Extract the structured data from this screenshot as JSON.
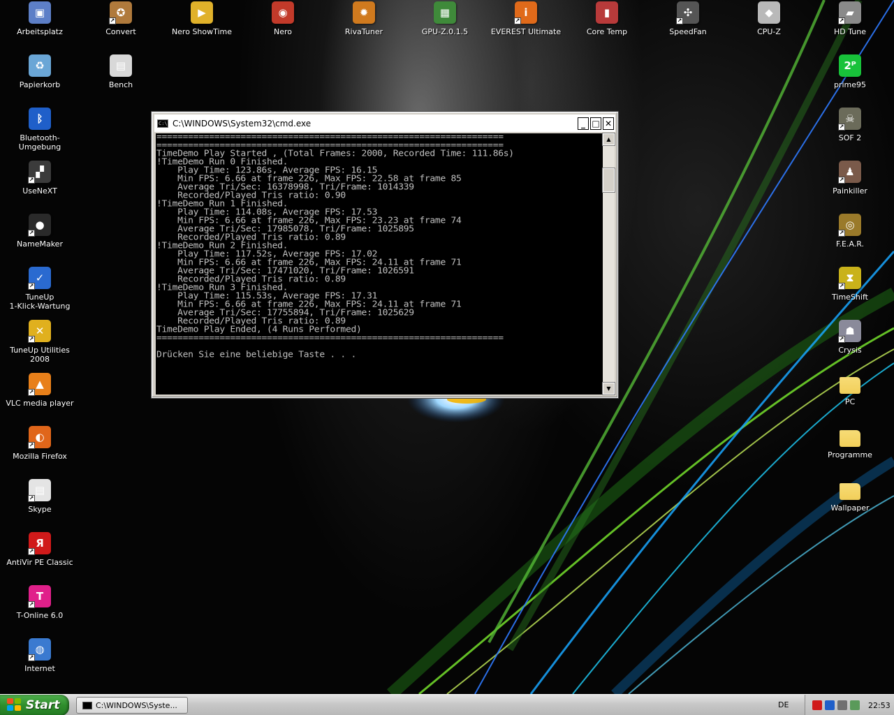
{
  "desktop": {
    "icons": [
      {
        "label": "Arbeitsplatz",
        "icon": "my-computer-icon",
        "color": "#5d7fc7",
        "glyph": "▣",
        "shortcut": false
      },
      {
        "label": "Convert",
        "icon": "convert-icon",
        "color": "#b07a3c",
        "glyph": "✪",
        "shortcut": true
      },
      {
        "label": "Nero ShowTime",
        "icon": "nero-showtime-icon",
        "color": "#e0b12a",
        "glyph": "▶",
        "shortcut": false
      },
      {
        "label": "Nero",
        "icon": "nero-icon",
        "color": "#c23a2a",
        "glyph": "◉",
        "shortcut": false
      },
      {
        "label": "RivaTuner",
        "icon": "rivatuner-icon",
        "color": "#d07a1e",
        "glyph": "✹",
        "shortcut": false
      },
      {
        "label": "GPU-Z.0.1.5",
        "icon": "gpu-z-icon",
        "color": "#3f8a3a",
        "glyph": "▦",
        "shortcut": false
      },
      {
        "label": "EVEREST Ultimate",
        "icon": "everest-icon",
        "color": "#e06a1a",
        "glyph": "i",
        "shortcut": true
      },
      {
        "label": "Core Temp",
        "icon": "core-temp-icon",
        "color": "#b83a3a",
        "glyph": "▮",
        "shortcut": false
      },
      {
        "label": "SpeedFan",
        "icon": "speedfan-icon",
        "color": "#555555",
        "glyph": "✣",
        "shortcut": true
      },
      {
        "label": "CPU-Z",
        "icon": "cpu-z-icon",
        "color": "#b9b9b9",
        "glyph": "◆",
        "shortcut": false
      },
      {
        "label": "HD Tune",
        "icon": "hd-tune-icon",
        "color": "#8a8a8a",
        "glyph": "▰",
        "shortcut": true
      },
      {
        "label": "Papierkorb",
        "icon": "recycle-bin-icon",
        "color": "#6aa6d6",
        "glyph": "♻",
        "shortcut": false
      },
      {
        "label": "Bench",
        "icon": "bench-icon",
        "color": "#d8d8d8",
        "glyph": "▤",
        "shortcut": false
      },
      {
        "label": "prime95",
        "icon": "prime95-icon",
        "color": "#18c23a",
        "glyph": "2ᴾ",
        "shortcut": false
      },
      {
        "label": "Bluetooth-Umgebung",
        "icon": "bluetooth-icon",
        "color": "#1f5fc9",
        "glyph": "ᛒ",
        "shortcut": false
      },
      {
        "label": "SOF 2",
        "icon": "sof2-icon",
        "color": "#6b6b5a",
        "glyph": "☠",
        "shortcut": true
      },
      {
        "label": "UseNeXT",
        "icon": "usenext-icon",
        "color": "#3b3b3b",
        "glyph": "▞",
        "shortcut": true
      },
      {
        "label": "Painkiller",
        "icon": "painkiller-icon",
        "color": "#7a5a4a",
        "glyph": "♟",
        "shortcut": true
      },
      {
        "label": "NameMaker",
        "icon": "namemaker-icon",
        "color": "#2a2a2a",
        "glyph": "●",
        "shortcut": true
      },
      {
        "label": "F.E.A.R.",
        "icon": "fear-icon",
        "color": "#9a7a2a",
        "glyph": "◎",
        "shortcut": true
      },
      {
        "label": "TuneUp\n1-Klick-Wartung",
        "icon": "tuneup-1click-icon",
        "color": "#2a6ad0",
        "glyph": "✓",
        "shortcut": true
      },
      {
        "label": "TimeShift",
        "icon": "timeshift-icon",
        "color": "#c9b21a",
        "glyph": "⧗",
        "shortcut": true
      },
      {
        "label": "TuneUp Utilities 2008",
        "icon": "tuneup-utilities-icon",
        "color": "#e0b01e",
        "glyph": "✕",
        "shortcut": true
      },
      {
        "label": "Crysis",
        "icon": "crysis-icon",
        "color": "#8a8a9a",
        "glyph": "☗",
        "shortcut": true
      },
      {
        "label": "VLC media player",
        "icon": "vlc-icon",
        "color": "#e8801a",
        "glyph": "▲",
        "shortcut": true
      },
      {
        "label": "PC",
        "icon": "folder-icon",
        "color": "#f2cf5a",
        "glyph": "",
        "shortcut": false
      },
      {
        "label": "Mozilla Firefox",
        "icon": "firefox-icon",
        "color": "#e0661a",
        "glyph": "◐",
        "shortcut": true
      },
      {
        "label": "Programme",
        "icon": "folder-icon",
        "color": "#f2cf5a",
        "glyph": "",
        "shortcut": false
      },
      {
        "label": "Skype",
        "icon": "skype-icon",
        "color": "#e4e4e4",
        "glyph": "▤",
        "shortcut": true
      },
      {
        "label": "Wallpaper",
        "icon": "folder-icon",
        "color": "#f2cf5a",
        "glyph": "",
        "shortcut": false
      },
      {
        "label": "AntiVir PE Classic",
        "icon": "antivir-icon",
        "color": "#d01a1a",
        "glyph": "Я",
        "shortcut": true
      },
      {
        "label": "T-Online 6.0",
        "icon": "t-online-icon",
        "color": "#e0208a",
        "glyph": "T",
        "shortcut": true
      },
      {
        "label": "Internet",
        "icon": "internet-icon",
        "color": "#3a7ad0",
        "glyph": "◍",
        "shortcut": true
      }
    ]
  },
  "cmd_window": {
    "title": "C:\\WINDOWS\\System32\\cmd.exe",
    "icon_text": "C:\\",
    "buttons": {
      "minimize": "_",
      "maximize": "□",
      "close": "✕"
    },
    "console_lines": [
      "==================================================================",
      "==================================================================",
      "TimeDemo Play Started , (Total Frames: 2000, Recorded Time: 111.86s)",
      "!TimeDemo Run 0 Finished.",
      "    Play Time: 123.86s, Average FPS: 16.15",
      "    Min FPS: 6.66 at frame 226, Max FPS: 22.58 at frame 85",
      "    Average Tri/Sec: 16378998, Tri/Frame: 1014339",
      "    Recorded/Played Tris ratio: 0.90",
      "!TimeDemo Run 1 Finished.",
      "    Play Time: 114.08s, Average FPS: 17.53",
      "    Min FPS: 6.66 at frame 226, Max FPS: 23.23 at frame 74",
      "    Average Tri/Sec: 17985078, Tri/Frame: 1025895",
      "    Recorded/Played Tris ratio: 0.89",
      "!TimeDemo Run 2 Finished.",
      "    Play Time: 117.52s, Average FPS: 17.02",
      "    Min FPS: 6.66 at frame 226, Max FPS: 24.11 at frame 71",
      "    Average Tri/Sec: 17471020, Tri/Frame: 1026591",
      "    Recorded/Played Tris ratio: 0.89",
      "!TimeDemo Run 3 Finished.",
      "    Play Time: 115.53s, Average FPS: 17.31",
      "    Min FPS: 6.66 at frame 226, Max FPS: 24.11 at frame 71",
      "    Average Tri/Sec: 17755894, Tri/Frame: 1025629",
      "    Recorded/Played Tris ratio: 0.89",
      "TimeDemo Play Ended, (4 Runs Performed)",
      "==================================================================",
      "",
      "Drücken Sie eine beliebige Taste . . ."
    ]
  },
  "taskbar": {
    "start_label": "Start",
    "tasks": [
      {
        "label": "C:\\WINDOWS\\Syste..."
      }
    ],
    "language": "DE",
    "clock": "22:53",
    "tray_icons": [
      {
        "icon": "antivir-tray-icon",
        "color": "#d01a1a"
      },
      {
        "icon": "bluetooth-tray-icon",
        "color": "#1f5fc9"
      },
      {
        "icon": "speedfan-tray-icon",
        "color": "#707070"
      },
      {
        "icon": "network-tray-icon",
        "color": "#5a9a5a"
      }
    ]
  },
  "colors": {
    "console_text": "#c0c0c0",
    "console_bg": "#000000",
    "taskbar": "#c8c8c8",
    "start_button": "#2f8e2c"
  }
}
